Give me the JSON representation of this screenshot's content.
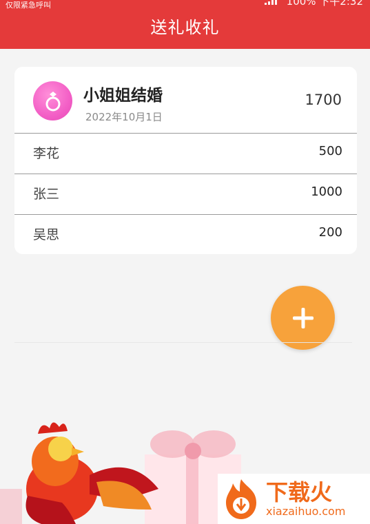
{
  "status_bar": {
    "left_text": "仅限紧急呼叫",
    "right_text": "100% 下午2:32"
  },
  "header": {
    "title": "送礼收礼"
  },
  "event": {
    "icon": "ring-icon",
    "title": "小姐姐结婚",
    "date": "2022年10月1日",
    "total": "1700"
  },
  "entries": [
    {
      "name": "李花",
      "amount": "500"
    },
    {
      "name": "张三",
      "amount": "1000"
    },
    {
      "name": "吴思",
      "amount": "200"
    }
  ],
  "fab": {
    "icon": "plus-icon"
  },
  "watermark": {
    "title": "下载火",
    "url": "xiazaihuo.com"
  },
  "colors": {
    "header": "#e43a3a",
    "fab": "#f7a23b",
    "ring_icon": "#f35fc6",
    "watermark": "#f06a1b"
  }
}
